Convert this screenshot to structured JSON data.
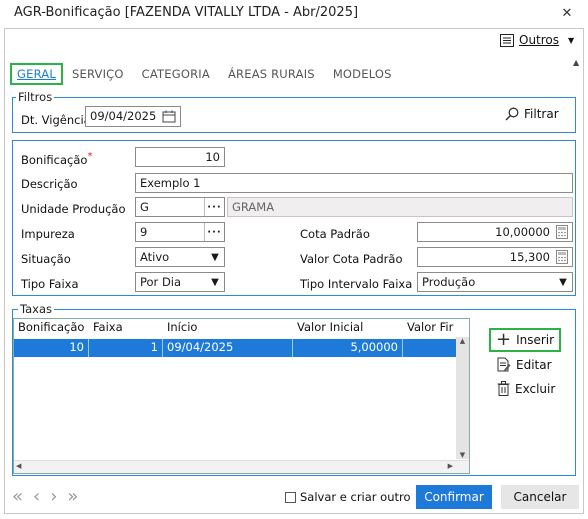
{
  "window": {
    "title": "AGR-Bonificação [FAZENDA VITALLY LTDA - Abr/2025]",
    "close_glyph": "✕"
  },
  "toolbar": {
    "outros_label": "Outros"
  },
  "tabs": [
    {
      "label": "GERAL"
    },
    {
      "label": "SERVIÇO"
    },
    {
      "label": "CATEGORIA"
    },
    {
      "label": "ÁREAS RURAIS"
    },
    {
      "label": "MODELOS"
    }
  ],
  "filtros": {
    "legend": "Filtros",
    "dt_vigencia_label": "Dt. Vigência",
    "dt_vigencia_value": "09/04/2025",
    "filtrar_label": "Filtrar"
  },
  "form": {
    "bonificacao_label": "Bonificação",
    "required_mark": "*",
    "bonificacao_value": "10",
    "descricao_label": "Descrição",
    "descricao_value": "Exemplo 1",
    "unidade_label": "Unidade Produção",
    "unidade_value": "G",
    "unidade_desc": "GRAMA",
    "impureza_label": "Impureza",
    "impureza_value": "9",
    "cota_padrao_label": "Cota Padrão",
    "cota_padrao_value": "10,00000",
    "situacao_label": "Situação",
    "situacao_value": "Ativo",
    "valor_cota_label": "Valor Cota Padrão",
    "valor_cota_value": "15,300",
    "tipo_faixa_label": "Tipo Faixa",
    "tipo_faixa_value": "Por Dia",
    "tipo_intervalo_label": "Tipo Intervalo Faixa",
    "tipo_intervalo_value": "Produção",
    "ellipsis": "···"
  },
  "taxas": {
    "legend": "Taxas",
    "columns": [
      "Bonificação",
      "Faixa",
      "Início",
      "Valor Inicial",
      "Valor Fir"
    ],
    "rows": [
      {
        "bonificacao": "10",
        "faixa": "1",
        "inicio": "09/04/2025",
        "valor_inicial": "5,00000",
        "valor_final": ""
      }
    ],
    "inserir_label": "Inserir",
    "editar_label": "Editar",
    "excluir_label": "Excluir"
  },
  "footer": {
    "salvar_label": "Salvar e criar outro",
    "confirmar_label": "Confirmar",
    "cancelar_label": "Cancelar"
  },
  "colors": {
    "accent": "#1e7ad8",
    "group_border": "#2e8bd2",
    "highlight": "#2bb34a",
    "required": "#e0202a"
  }
}
